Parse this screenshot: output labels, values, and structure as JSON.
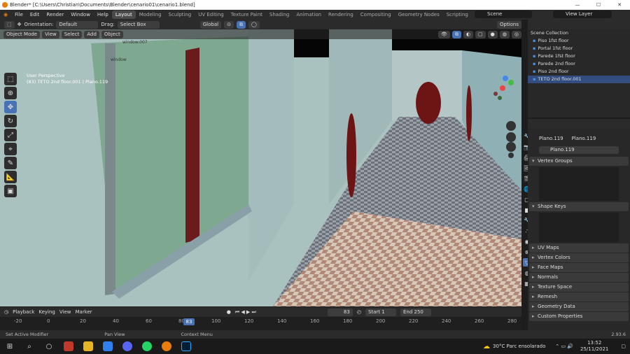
{
  "window": {
    "title": "Blender* [C:\\Users\\Christian\\Documents\\Blender\\cenario01\\cenario1.blend]"
  },
  "menu": [
    "File",
    "Edit",
    "Render",
    "Window",
    "Help"
  ],
  "workspaces": [
    "Layout",
    "Modeling",
    "Sculpting",
    "UV Editing",
    "Texture Paint",
    "Shading",
    "Animation",
    "Rendering",
    "Compositing",
    "Geometry Nodes",
    "Scripting"
  ],
  "active_workspace": "Layout",
  "scene": "Scene",
  "view_layer": "View Layer",
  "tool_header": {
    "orientation_label": "Orientation:",
    "orientation_value": "Default",
    "drag_label": "Drag:",
    "drag_value": "Select Box",
    "transform": "Global",
    "options": "Options"
  },
  "viewport_header": {
    "mode": "Object Mode",
    "items": [
      "View",
      "Select",
      "Add",
      "Object"
    ]
  },
  "viewport": {
    "perspective": "User Perspective",
    "object_info": "(83) TETO 2nd floor.001 | Plano.119",
    "scene_labels": [
      "window",
      "window.007"
    ]
  },
  "outliner": {
    "collection": "Scene Collection",
    "items": [
      "Piso 1fst floor",
      "Portal 1fst floor",
      "Parede 1fst floor",
      "Parede 2nd floor",
      "Piso 2nd floor",
      "TETO 2nd floor.001"
    ]
  },
  "properties": {
    "object_name": "Plano.119",
    "mesh_name": "Plano.119",
    "data_field": "Plano.119",
    "open_panels": [
      "Vertex Groups",
      "Shape Keys"
    ],
    "closed_panels": [
      "UV Maps",
      "Vertex Colors",
      "Face Maps",
      "Normals",
      "Texture Space",
      "Remesh",
      "Geometry Data",
      "Custom Properties"
    ]
  },
  "timeline": {
    "menus": [
      "Playback",
      "Keying",
      "View",
      "Marker"
    ],
    "current_frame": "83",
    "start_label": "Start",
    "start": "1",
    "end_label": "End",
    "end": "250",
    "ruler": [
      "-20",
      "0",
      "20",
      "40",
      "60",
      "80",
      "100",
      "120",
      "140",
      "160",
      "180",
      "200",
      "220",
      "240",
      "260",
      "280"
    ],
    "playhead": "83"
  },
  "statusbar": {
    "left": "Set Active Modifier",
    "middle": "Pan View",
    "right": "Context Menu",
    "version": "2.93.6"
  },
  "taskbar": {
    "weather": "30°C  Parc ensolarado",
    "time": "13:52",
    "date": "25/11/2021"
  }
}
